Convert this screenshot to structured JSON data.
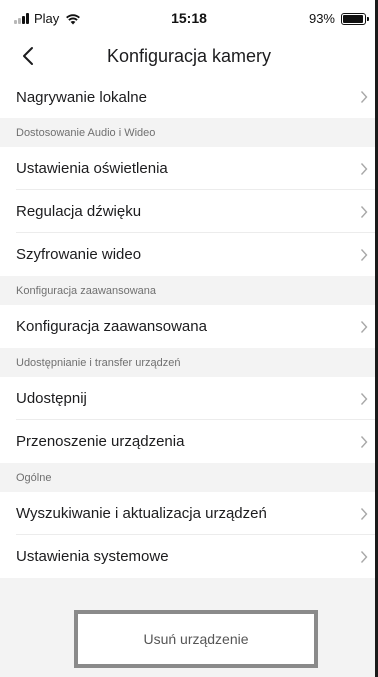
{
  "status_bar": {
    "carrier": "Play",
    "time": "15:18",
    "battery_text": "93%",
    "battery_level": 0.93
  },
  "header": {
    "title": "Konfiguracja kamery",
    "back_icon": "chevron-left-icon"
  },
  "rows": {
    "local_recording": "Nagrywanie lokalne",
    "lighting": "Ustawienia oświetlenia",
    "sound": "Regulacja dźwięku",
    "encryption": "Szyfrowanie wideo",
    "advanced": "Konfiguracja zaawansowana",
    "share": "Udostępnij",
    "transfer": "Przenoszenie urządzenia",
    "search_update": "Wyszukiwanie i aktualizacja urządzeń",
    "system": "Ustawienia systemowe"
  },
  "sections": {
    "audio_video": "Dostosowanie Audio i Wideo",
    "advanced": "Konfiguracja zaawansowana",
    "sharing": "Udostępnianie i transfer urządzeń",
    "general": "Ogólne"
  },
  "footer": {
    "delete_label": "Usuń urządzenie"
  },
  "colors": {
    "text": "#1c1c1e",
    "section_text": "#707070",
    "section_bg": "#f3f3f3",
    "chevron": "#a8a8a8"
  }
}
